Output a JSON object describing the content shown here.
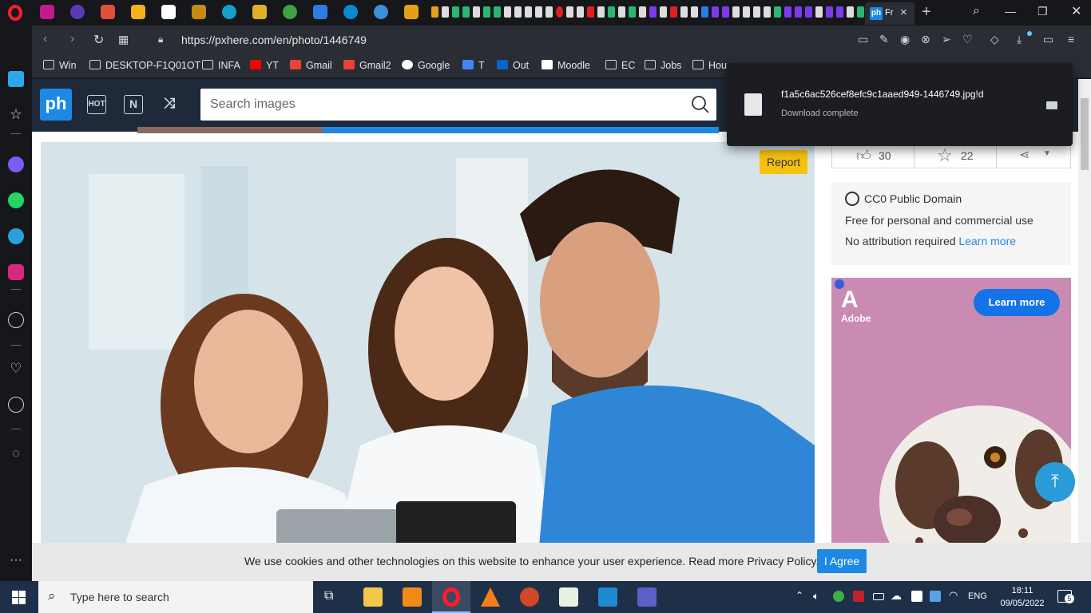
{
  "browser": {
    "active_tab_title": "Fr",
    "url": "https://pxhere.com/en/photo/1446749",
    "bookmarks": [
      "Win",
      "DESKTOP-F1Q01OT",
      "INFA",
      "YT",
      "Gmail",
      "Gmail2",
      "Google",
      "T",
      "Out",
      "Moodle",
      "EC",
      "Jobs",
      "Hou"
    ]
  },
  "header": {
    "logo_text": "ph",
    "search_placeholder": "Search images"
  },
  "photo": {
    "report_label": "Report"
  },
  "stats": {
    "likes": "30",
    "favorites": "22"
  },
  "license": {
    "title": "CC0 Public Domain",
    "line1": "Free for personal and commercial use",
    "line2": "No attribution required",
    "learn_more": "Learn more"
  },
  "ad": {
    "brand": "Adobe",
    "button": "Learn more"
  },
  "cookie": {
    "message": "We use cookies and other technologies on this website to enhance your user experience. Read more Privacy Policy.",
    "button": "I Agree"
  },
  "download": {
    "filename": "f1a5c6ac526cef8efc9c1aaed949-1446749.jpg!d",
    "status": "Download complete"
  },
  "taskbar": {
    "search_placeholder": "Type here to search",
    "language": "ENG",
    "time": "18:11",
    "date": "09/05/2022",
    "notification_count": "5"
  },
  "colors": {
    "accent": "#1e88e5",
    "report": "#f7c20e",
    "header_bg": "#1e2a3a"
  }
}
